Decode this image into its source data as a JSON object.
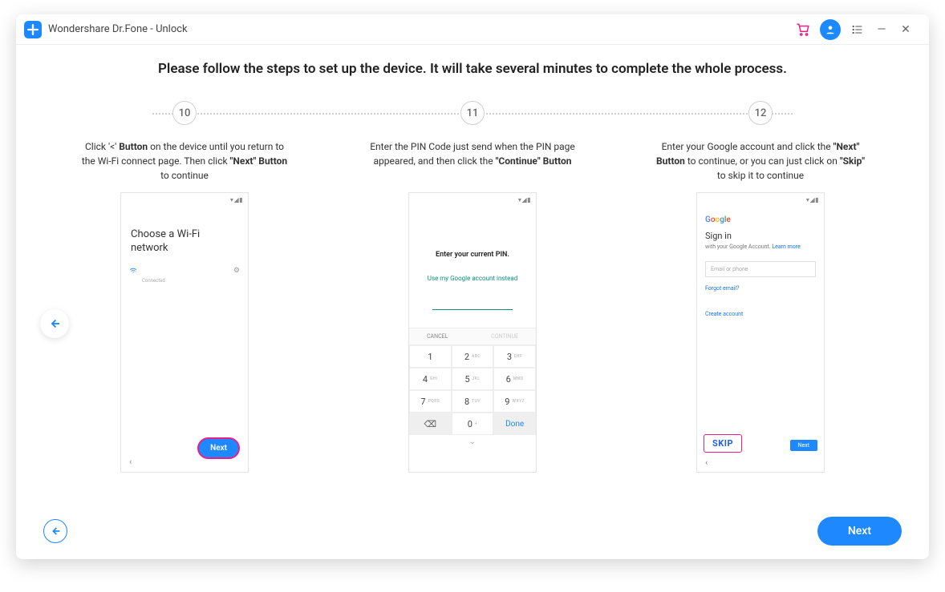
{
  "titlebar": {
    "title": "Wondershare Dr.Fone - Unlock"
  },
  "instruction": "Please follow the steps to set up the device. It will take several minutes to complete the whole process.",
  "steps": {
    "s10": {
      "num": "10",
      "desc_pre": "Click '<' ",
      "desc_b1": "Button",
      "desc_mid": " on the device until you return to the Wi-Fi connect page. Then click ",
      "desc_b2": "\"Next\" Button",
      "desc_post": " to continue",
      "phone": {
        "title": "Choose a Wi-Fi network",
        "connected": "Connected",
        "next": "Next"
      }
    },
    "s11": {
      "num": "11",
      "desc_pre": "Enter the PIN Code just send when the PIN page appeared, and then click the ",
      "desc_b1": "\"Continue\" Button",
      "phone": {
        "title": "Enter your current PIN.",
        "link": "Use my Google account instead",
        "cancel": "CANCEL",
        "cont": "CONTINUE",
        "done": "Done",
        "keys": {
          "k1": "1",
          "k2": "2",
          "k2s": "ABC",
          "k3": "3",
          "k3s": "DEF",
          "k4": "4",
          "k4s": "GHI",
          "k5": "5",
          "k5s": "JKL",
          "k6": "6",
          "k6s": "MNO",
          "k7": "7",
          "k7s": "PQRS",
          "k8": "8",
          "k8s": "TUV",
          "k9": "9",
          "k9s": "WXYZ",
          "kbs": "⌫",
          "k0": "0",
          "k0s": "+"
        }
      }
    },
    "s12": {
      "num": "12",
      "desc_pre": "Enter your Google account and click the ",
      "desc_b1": "\"Next\" Button",
      "desc_mid": " to continue, or you can just click on ",
      "desc_b2": "\"Skip\"",
      "desc_post": " to skip it to continue",
      "phone": {
        "signin": "Sign in",
        "sub_pre": "with your Google Account. ",
        "sub_link": "Learn more",
        "placeholder": "Email or phone",
        "forgot": "Forgot email?",
        "create": "Create account",
        "skip": "SKIP",
        "next": "Next"
      }
    }
  },
  "footer": {
    "next": "Next"
  }
}
